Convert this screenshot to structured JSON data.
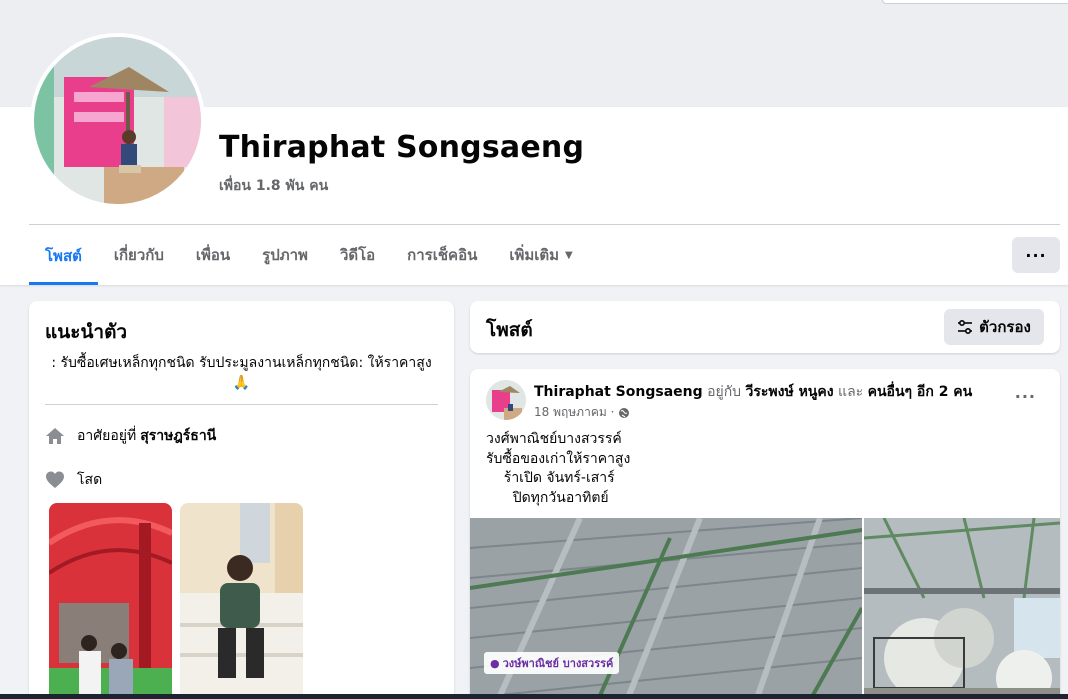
{
  "profile": {
    "name": "Thiraphat Songsaeng",
    "friends": "เพื่อน 1.8 พัน คน"
  },
  "tabs": [
    {
      "label": "โพสต์",
      "active": true
    },
    {
      "label": "เกี่ยวกับ"
    },
    {
      "label": "เพื่อน"
    },
    {
      "label": "รูปภาพ"
    },
    {
      "label": "วิดีโอ"
    },
    {
      "label": "การเช็คอิน"
    },
    {
      "label": "เพิ่มเติม"
    }
  ],
  "more_button": "···",
  "intro": {
    "title": "แนะนำตัว",
    "bio": ": รับซื้อเศษเหล็กทุกชนิด รับประมูลงานเหล็กทุกชนิด: ให้ราคาสูง 🙏",
    "lives_in_prefix": "อาศัยอยู่ที่",
    "lives_in_place": "สุราษฎร์ธานี",
    "relationship": "โสด"
  },
  "posts_header": {
    "title": "โพสต์",
    "filter_label": "ตัวกรอง"
  },
  "post": {
    "author": "Thiraphat Songsaeng",
    "with_text": "อยู่กับ",
    "tagged_person": "วีระพงษ์ หนูคง",
    "and_text": "และ",
    "others": "คนอื่นๆ อีก 2 คน",
    "time": "18 พฤษภาคม ·",
    "text": "วงศ์พาณิชย์บางสวรรค์\nรับซื้อของเก่าให้ราคาสูง\n    ร้าเปิด จันทร์-เสาร์\n      ปิดทุกวันอาทิตย์",
    "location_tag": "วงษ์พาณิชย์ บางสวรรค์",
    "dots": "···"
  },
  "colors": {
    "accent": "#1877f2",
    "background": "#f0f2f5",
    "secondary_text": "#65676b"
  }
}
